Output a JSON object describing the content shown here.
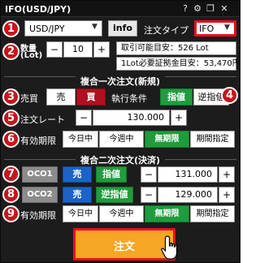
{
  "window": {
    "title": "IFO(USD/JPY)",
    "icons": [
      "help-icon",
      "gear-icon",
      "restore-icon",
      "close-icon"
    ]
  },
  "header": {
    "symbol": "USD/JPY",
    "info_label": "info",
    "order_type_label": "注文タイプ",
    "order_type_value": "IFO"
  },
  "quantity": {
    "label_line1": "数量",
    "label_line2": "(Lot)",
    "minus": "−",
    "value": "10",
    "plus": "+",
    "available": "取引可能目安：526 Lot",
    "margin": "1Lot必要証拠金目安：53,470円"
  },
  "first_order": {
    "section_title": "複合一次注文(新規)",
    "side_label": "売買",
    "sell": "売",
    "buy": "買",
    "condition_label": "執行条件",
    "limit": "指値",
    "stop": "逆指値",
    "rate_label": "注文レート",
    "rate_minus": "−",
    "rate_value": "130.000",
    "rate_plus": "+",
    "expiry_label": "有効期限",
    "expiry_options": [
      "今日中",
      "今週中",
      "無期限",
      "期間指定"
    ],
    "expiry_selected": "無期限"
  },
  "second_order": {
    "section_title": "複合二次注文(決済)",
    "oco1": {
      "name": "OCO1",
      "side": "売",
      "type": "指値",
      "minus": "−",
      "value": "131.000",
      "plus": "+"
    },
    "oco2": {
      "name": "OCO2",
      "side": "売",
      "type": "逆指値",
      "minus": "−",
      "value": "129.000",
      "plus": "+"
    },
    "expiry_label": "有効期限",
    "expiry_options": [
      "今日中",
      "今週中",
      "無期限",
      "期間指定"
    ],
    "expiry_selected": "無期限"
  },
  "submit_label": "注文",
  "annotations": [
    "1",
    "2",
    "3",
    "4",
    "5",
    "6",
    "7",
    "8",
    "9"
  ],
  "colors": {
    "background": "#1c1c1c",
    "selected_green": "#1f9c3e",
    "buy_red": "#b01020",
    "sell_blue": "#1a63c8",
    "submit_orange": "#f5a623",
    "annotation_red": "#c4161c"
  }
}
